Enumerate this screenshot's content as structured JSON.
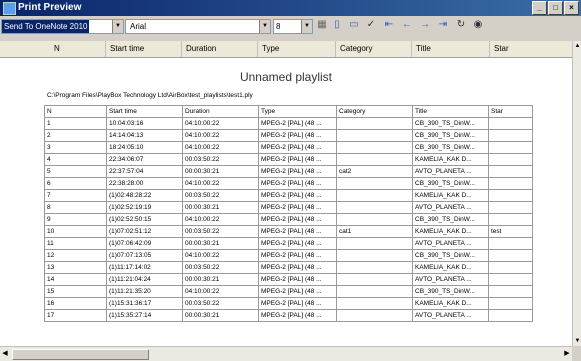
{
  "window": {
    "title": "Print Preview",
    "min_btn": "_",
    "max_btn": "□",
    "close_btn": "×"
  },
  "toolbar": {
    "send_to": "Send To OneNote 2010",
    "font": "Arial",
    "font_size": "8"
  },
  "column_headers": [
    "N",
    "Start time",
    "Duration",
    "Type",
    "Category",
    "Title",
    "Star"
  ],
  "document": {
    "title": "Unnamed playlist",
    "path": "C:\\Program Files\\PlayBox Technology Ltd\\AirBox\\test_playlists\\test1.ply",
    "header": [
      "N",
      "Start time",
      "Duration",
      "Type",
      "Category",
      "Title",
      "Star"
    ],
    "rows": [
      [
        "1",
        "10:04:03:16",
        "04:10:00:22",
        "MPEG-2 [PAL] (48 ...",
        "",
        "CB_390_TS_DinW...",
        ""
      ],
      [
        "2",
        "14:14:04:13",
        "04:10:00:22",
        "MPEG-2 [PAL] (48 ...",
        "",
        "CB_390_TS_DinW...",
        ""
      ],
      [
        "3",
        "18:24:05:10",
        "04:10:00:22",
        "MPEG-2 [PAL] (48 ...",
        "",
        "CB_390_TS_DinW...",
        ""
      ],
      [
        "4",
        "22:34:06:07",
        "00:03:50:22",
        "MPEG-2 [PAL] (48 ...",
        "",
        "KAMELIA_KAK D...",
        ""
      ],
      [
        "5",
        "22:37:57:04",
        "00:00:30:21",
        "MPEG-2 [PAL] (48 ...",
        "cat2",
        "AVTO_PLANETA ...",
        ""
      ],
      [
        "6",
        "22:38:28:00",
        "04:10:00:22",
        "MPEG-2 [PAL] (48 ...",
        "",
        "CB_390_TS_DinW...",
        ""
      ],
      [
        "7",
        "(1)02:48:28:22",
        "00:03:50:22",
        "MPEG-2 [PAL] (48 ...",
        "",
        "KAMELIA_KAK D...",
        ""
      ],
      [
        "8",
        "(1)02:52:19:19",
        "00:00:30:21",
        "MPEG-2 [PAL] (48 ...",
        "",
        "AVTO_PLANETA ...",
        ""
      ],
      [
        "9",
        "(1)02:52:50:15",
        "04:10:00:22",
        "MPEG-2 [PAL] (48 ...",
        "",
        "CB_390_TS_DinW...",
        ""
      ],
      [
        "10",
        "(1)07:02:51:12",
        "00:03:50:22",
        "MPEG-2 [PAL] (48 ...",
        "cat1",
        "KAMELIA_KAK D...",
        "test"
      ],
      [
        "11",
        "(1)07:06:42:09",
        "00:00:30:21",
        "MPEG-2 [PAL] (48 ...",
        "",
        "AVTO_PLANETA ...",
        ""
      ],
      [
        "12",
        "(1)07:07:13:05",
        "04:10:00:22",
        "MPEG-2 [PAL] (48 ...",
        "",
        "CB_390_TS_DinW...",
        ""
      ],
      [
        "13",
        "(1)11:17:14:02",
        "00:03:50:22",
        "MPEG-2 [PAL] (48 ...",
        "",
        "KAMELIA_KAK D...",
        ""
      ],
      [
        "14",
        "(1)11:21:04:24",
        "00:00:30:21",
        "MPEG-2 [PAL] (48 ...",
        "",
        "AVTO_PLANETA ...",
        ""
      ],
      [
        "15",
        "(1)11:21:35:20",
        "04:10:00:22",
        "MPEG-2 [PAL] (48 ...",
        "",
        "CB_390_TS_DinW...",
        ""
      ],
      [
        "16",
        "(1)15:31:36:17",
        "00:03:50:22",
        "MPEG-2 [PAL] (48 ...",
        "",
        "KAMELIA_KAK D...",
        ""
      ],
      [
        "17",
        "(1)15:35:27:14",
        "00:00:30:21",
        "MPEG-2 [PAL] (48 ...",
        "",
        "AVTO_PLANETA ...",
        ""
      ]
    ]
  },
  "icons": [
    "print-icon",
    "page-icon",
    "landscape-icon",
    "check-icon",
    "first-page-icon",
    "prev-page-icon",
    "next-page-icon",
    "last-page-icon",
    "refresh-icon",
    "eye-icon"
  ]
}
